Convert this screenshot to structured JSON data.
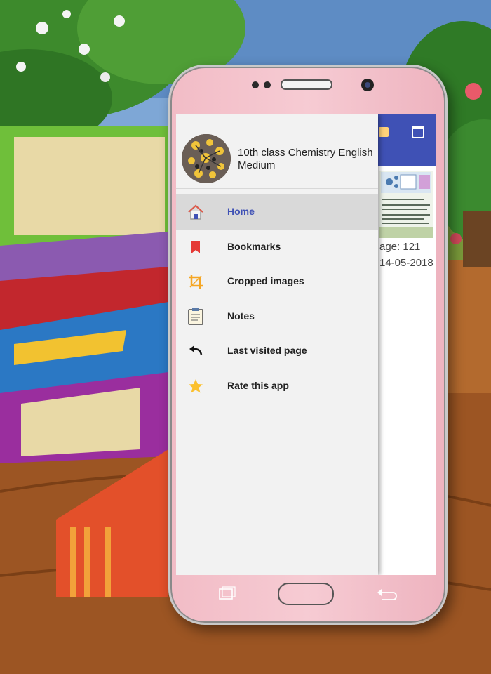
{
  "drawer": {
    "app_title": "10th class Chemistry English Medium",
    "items": [
      {
        "label": "Home",
        "icon": "home-icon"
      },
      {
        "label": "Bookmarks",
        "icon": "bookmark-icon"
      },
      {
        "label": "Cropped images",
        "icon": "crop-icon"
      },
      {
        "label": "Notes",
        "icon": "notes-icon"
      },
      {
        "label": "Last visited page",
        "icon": "undo-icon"
      },
      {
        "label": "Rate this app",
        "icon": "star-icon"
      }
    ]
  },
  "behind": {
    "page_label": "age: 121",
    "date_label": "14-05-2018"
  },
  "colors": {
    "primary": "#3f51b5",
    "bookmark": "#e53935",
    "crop": "#f5a623",
    "star": "#fbc02d"
  }
}
